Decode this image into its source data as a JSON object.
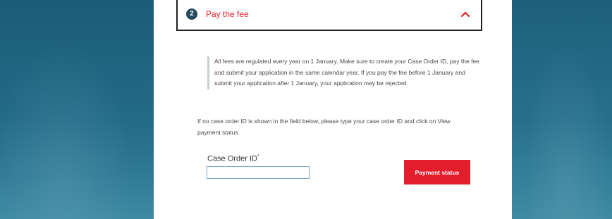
{
  "step": {
    "number": "2",
    "title": "Pay the fee",
    "toggle_icon": "chevron-up-icon",
    "accent_color": "#e1222a"
  },
  "info": {
    "text": "All fees are regulated every year on 1 January. Make sure to create your Case Order ID, pay the fee and submit your application in the same calendar year. If you pay the fee before 1 January and submit your application after 1 January, your application may be rejected."
  },
  "help": {
    "text": "If no case order ID is shown in the field below, please type your case order ID and click on View payment status."
  },
  "form": {
    "case_order_label": "Case Order ID",
    "required_mark": "*",
    "case_order_value": "",
    "payment_button_label": "Payment status",
    "button_color": "#e41d2d"
  }
}
